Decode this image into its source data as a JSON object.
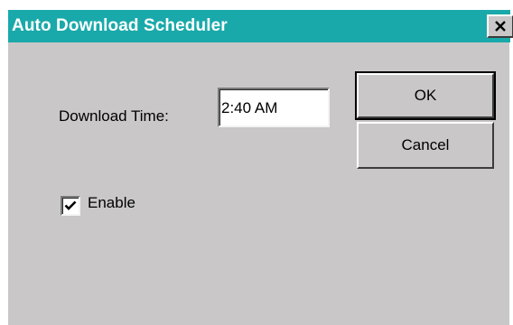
{
  "window": {
    "title": "Auto Download Scheduler"
  },
  "form": {
    "download_time_label": "Download Time:",
    "download_time_value": "2:40 AM",
    "enable_label": "Enable",
    "enable_checked": true
  },
  "buttons": {
    "ok_label": "OK",
    "cancel_label": "Cancel"
  },
  "icons": {
    "close": "close-icon",
    "check": "checkmark-icon"
  },
  "colors": {
    "titlebar": "#1aa9aa",
    "dialog_face": "#c9c7c7"
  }
}
